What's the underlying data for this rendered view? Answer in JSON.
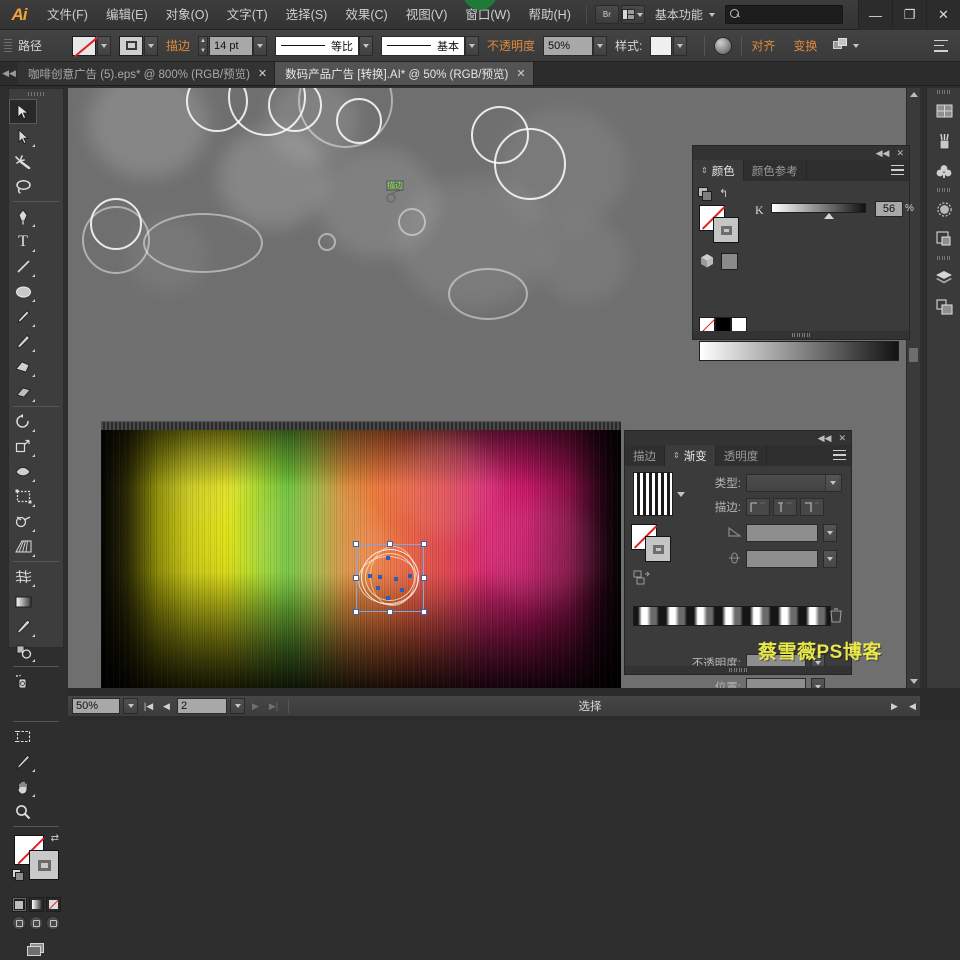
{
  "app": {
    "name": "Ai",
    "title": "Adobe Illustrator"
  },
  "menubar": {
    "items": [
      "文件(F)",
      "编辑(E)",
      "对象(O)",
      "文字(T)",
      "选择(S)",
      "效果(C)",
      "视图(V)",
      "窗口(W)",
      "帮助(H)"
    ],
    "bridge_label": "Br",
    "workspace": "基本功能",
    "search_placeholder": "",
    "window_controls": {
      "minimize": "—",
      "maximize": "❐",
      "close": "✕"
    }
  },
  "controlbar": {
    "context_label": "路径",
    "fill_label": "fill-none",
    "stroke_label": "描边",
    "stroke_weight": "14 pt",
    "profile_label": "等比",
    "brush_label": "基本",
    "opacity_label": "不透明度",
    "opacity_value": "50%",
    "style_label": "样式:",
    "align_label": "对齐",
    "transform_label": "变换",
    "recolor_label": "recolor-artwork"
  },
  "tabs": [
    {
      "label": "咖啡创意广告 (5).eps* @ 800% (RGB/预览)",
      "active": false,
      "close": "✕"
    },
    {
      "label": "数码产品广告 [转换].AI* @ 50% (RGB/预览)",
      "active": true,
      "close": "✕"
    }
  ],
  "toolbar": {
    "tools": [
      "selection-tool",
      "direct-selection-tool",
      "magic-wand-tool",
      "lasso-tool",
      "pen-tool",
      "type-tool",
      "line-segment-tool",
      "ellipse-tool",
      "paintbrush-tool",
      "pencil-tool",
      "blob-brush-tool",
      "eraser-tool",
      "rotate-tool",
      "scale-tool",
      "width-tool",
      "free-transform-tool",
      "shape-builder-tool",
      "perspective-grid-tool",
      "mesh-tool",
      "gradient-tool",
      "eyedropper-tool",
      "blend-tool",
      "symbol-sprayer-tool",
      "column-graph-tool",
      "artboard-tool",
      "slice-tool",
      "hand-tool",
      "zoom-tool"
    ],
    "fill_stroke": {
      "fill": "none",
      "stroke": "gray"
    },
    "modes": [
      "color-mode",
      "gradient-mode",
      "none-mode"
    ],
    "screen_modes": [
      "normal-screen",
      "full-screen-menubar",
      "full-screen"
    ]
  },
  "right_rail": {
    "items": [
      "artboards-icon",
      "brushes-icon",
      "symbols-icon",
      "appearance-icon",
      "transparency-icon",
      "layers-icon",
      "artboard-panel-icon"
    ]
  },
  "color_panel": {
    "tabs": [
      {
        "label": "颜色",
        "active": true
      },
      {
        "label": "颜色参考",
        "active": false
      }
    ],
    "channel_label": "K",
    "channel_value": "56",
    "percent": "%",
    "collapse": "◀◀",
    "close": "✕"
  },
  "gradient_panel": {
    "tabs": [
      {
        "label": "描边",
        "active": false
      },
      {
        "label": "渐变",
        "active": true
      },
      {
        "label": "透明度",
        "active": false
      }
    ],
    "type_label": "类型:",
    "type_value": "",
    "stroke_label": "描边:",
    "angle_label": "angle",
    "angle_value": "",
    "aspect_label": "aspect-ratio",
    "aspect_value": "",
    "opacity_label": "不透明度:",
    "opacity_value": "",
    "location_label": "位置:",
    "location_value": "",
    "collapse": "◀◀",
    "close": "✕"
  },
  "canvas": {
    "stroke_annotation": "描边",
    "watermark": "蔡雪薇PS博客"
  },
  "statusbar": {
    "zoom": "50%",
    "page": "2",
    "status_text": "选择",
    "first": "|◀",
    "prev": "◀",
    "next": "▶",
    "last": "▶|"
  },
  "colors": {
    "app_bg": "#2e2e2e",
    "panel_bg": "#3b3b3b",
    "accent_orange": "#e0893c",
    "watermark_yellow": "#e8e84a",
    "selection_blue": "#7fa7e8",
    "canvas_gray": "#6e6e6e"
  }
}
